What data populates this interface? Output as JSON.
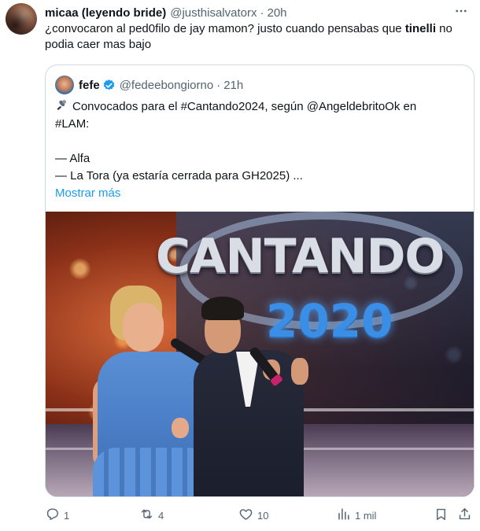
{
  "author": {
    "name": "micaa (leyendo bride)",
    "handle": "@justhisalvatorx",
    "separator": "·",
    "time": "20h"
  },
  "tweet": {
    "text_part1": "¿convocaron al ped0filo de jay mamon? justo cuando pensabas que ",
    "text_bold": "tinelli",
    "text_part2": " no podia caer mas bajo"
  },
  "quoted": {
    "name": "fefe",
    "handle": "@fedeebongiorno",
    "separator": "·",
    "time": "21h",
    "line1": "Convocados para el #Cantando2024, según @AngeldebritoOk en",
    "line2": "#LAM:",
    "line3": "",
    "line4": "— Alfa",
    "line5": "— La Tora (ya estaría cerrada para GH2025) ...",
    "show_more": "Mostrar más",
    "media": {
      "logo_text": "CANTANDO",
      "year_text": "2020"
    }
  },
  "actions": {
    "replies": "1",
    "retweets": "4",
    "likes": "10",
    "views": "1 mil"
  },
  "icons": {
    "more": "more-icon",
    "verified": "verified-icon",
    "reply": "reply-icon",
    "retweet": "retweet-icon",
    "like": "heart-icon",
    "views": "views-icon",
    "bookmark": "bookmark-icon",
    "share": "share-icon",
    "mic_emoji": "microphone-icon"
  },
  "colors": {
    "text": "#0f1419",
    "secondary": "#536471",
    "link": "#1d9bf0",
    "border": "#cfd9de",
    "verified": "#1d9bf0"
  }
}
